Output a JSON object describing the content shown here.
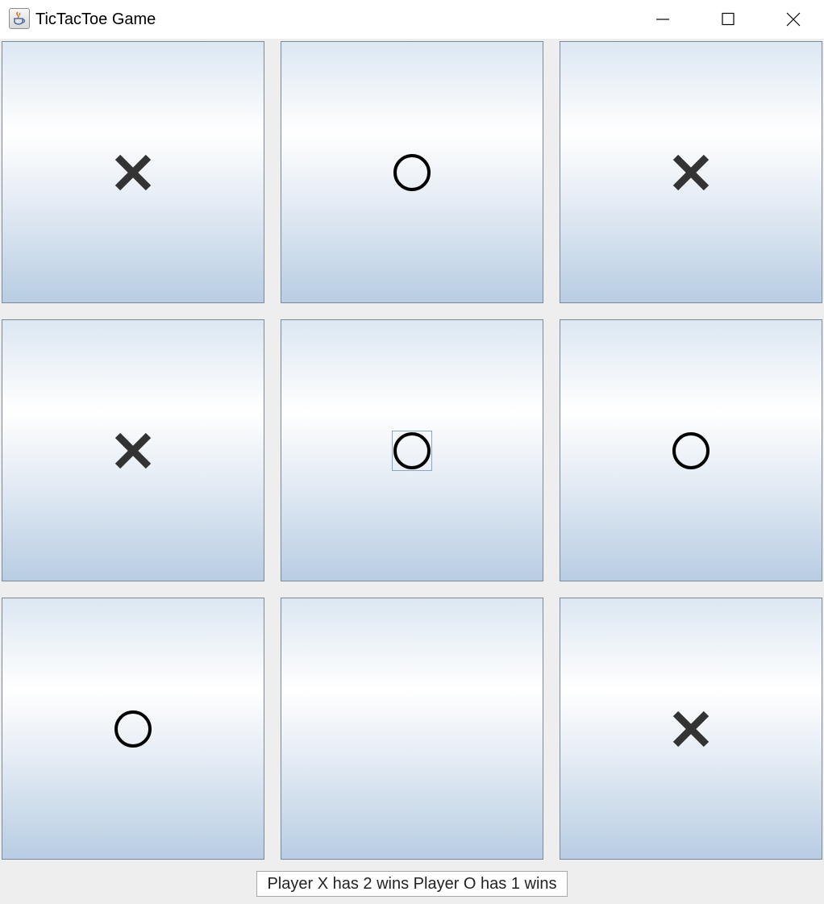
{
  "window": {
    "title": "TicTacToe Game",
    "app_icon": "java-cup-icon",
    "controls": [
      "minimize-icon",
      "maximize-icon",
      "close-icon"
    ]
  },
  "board": {
    "cells": [
      "X",
      "O",
      "X",
      "X",
      "O",
      "O",
      "O",
      "",
      "X"
    ],
    "focused_cell_index": 4
  },
  "status": {
    "text": "Player X has 2 wins Player O has 1 wins"
  },
  "colors": {
    "mark": "#333333",
    "cell_gradient_top": "#dce7f2",
    "cell_gradient_mid": "#ffffff",
    "cell_gradient_bottom": "#b8cde3",
    "background": "#eeeeee"
  }
}
